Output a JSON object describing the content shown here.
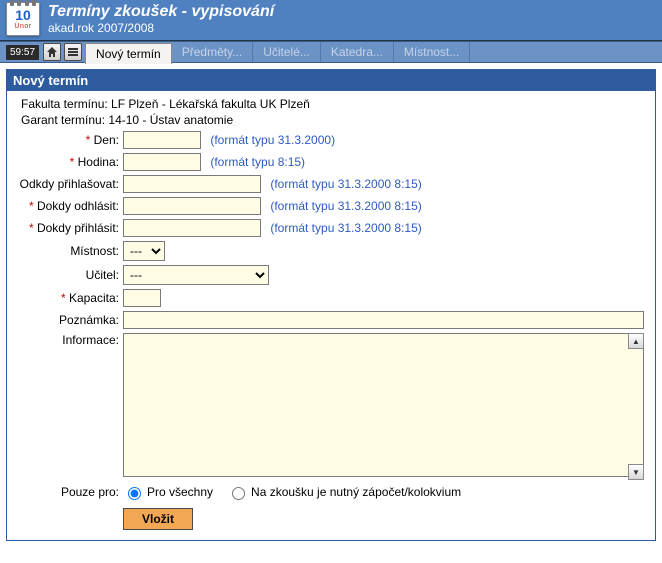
{
  "calendar_icon": {
    "day": "10",
    "month": "Únor"
  },
  "header": {
    "title": "Termíny zkoušek - vypisování",
    "subtitle": "akad.rok 2007/2008"
  },
  "toolbar": {
    "time": "59:57"
  },
  "tabs": [
    {
      "label": "Nový termín",
      "active": true
    },
    {
      "label": "Předměty...",
      "active": false
    },
    {
      "label": "Učitelé...",
      "active": false
    },
    {
      "label": "Katedra...",
      "active": false
    },
    {
      "label": "Místnost...",
      "active": false
    }
  ],
  "panel": {
    "title": "Nový termín",
    "info": {
      "faculty_label": "Fakulta termínu:",
      "faculty_value": "LF Plzeň - Lékařská fakulta UK Plzeň",
      "garant_label": "Garant termínu:",
      "garant_value": "14-10 - Ústav anatomie"
    },
    "fields": {
      "den_label": "Den:",
      "den_hint": "(formát typu 31.3.2000)",
      "hodina_label": "Hodina:",
      "hodina_hint": "(formát typu 8:15)",
      "odkdy_label": "Odkdy přihlašovat:",
      "odkdy_hint": "(formát typu 31.3.2000 8:15)",
      "dokdy_odhlasit_label": "Dokdy odhlásit:",
      "dokdy_odhlasit_hint": "(formát typu 31.3.2000 8:15)",
      "dokdy_prihlasit_label": "Dokdy přihlásit:",
      "dokdy_prihlasit_hint": "(formát typu 31.3.2000 8:15)",
      "mistnost_label": "Místnost:",
      "mistnost_selected": "---",
      "ucitel_label": "Učitel:",
      "ucitel_selected": "---",
      "kapacita_label": "Kapacita:",
      "poznamka_label": "Poznámka:",
      "informace_label": "Informace:",
      "pouze_label": "Pouze pro:",
      "radio_all": "Pro všechny",
      "radio_exam": "Na zkoušku je nutný zápočet/kolokvium",
      "submit": "Vložit"
    }
  }
}
